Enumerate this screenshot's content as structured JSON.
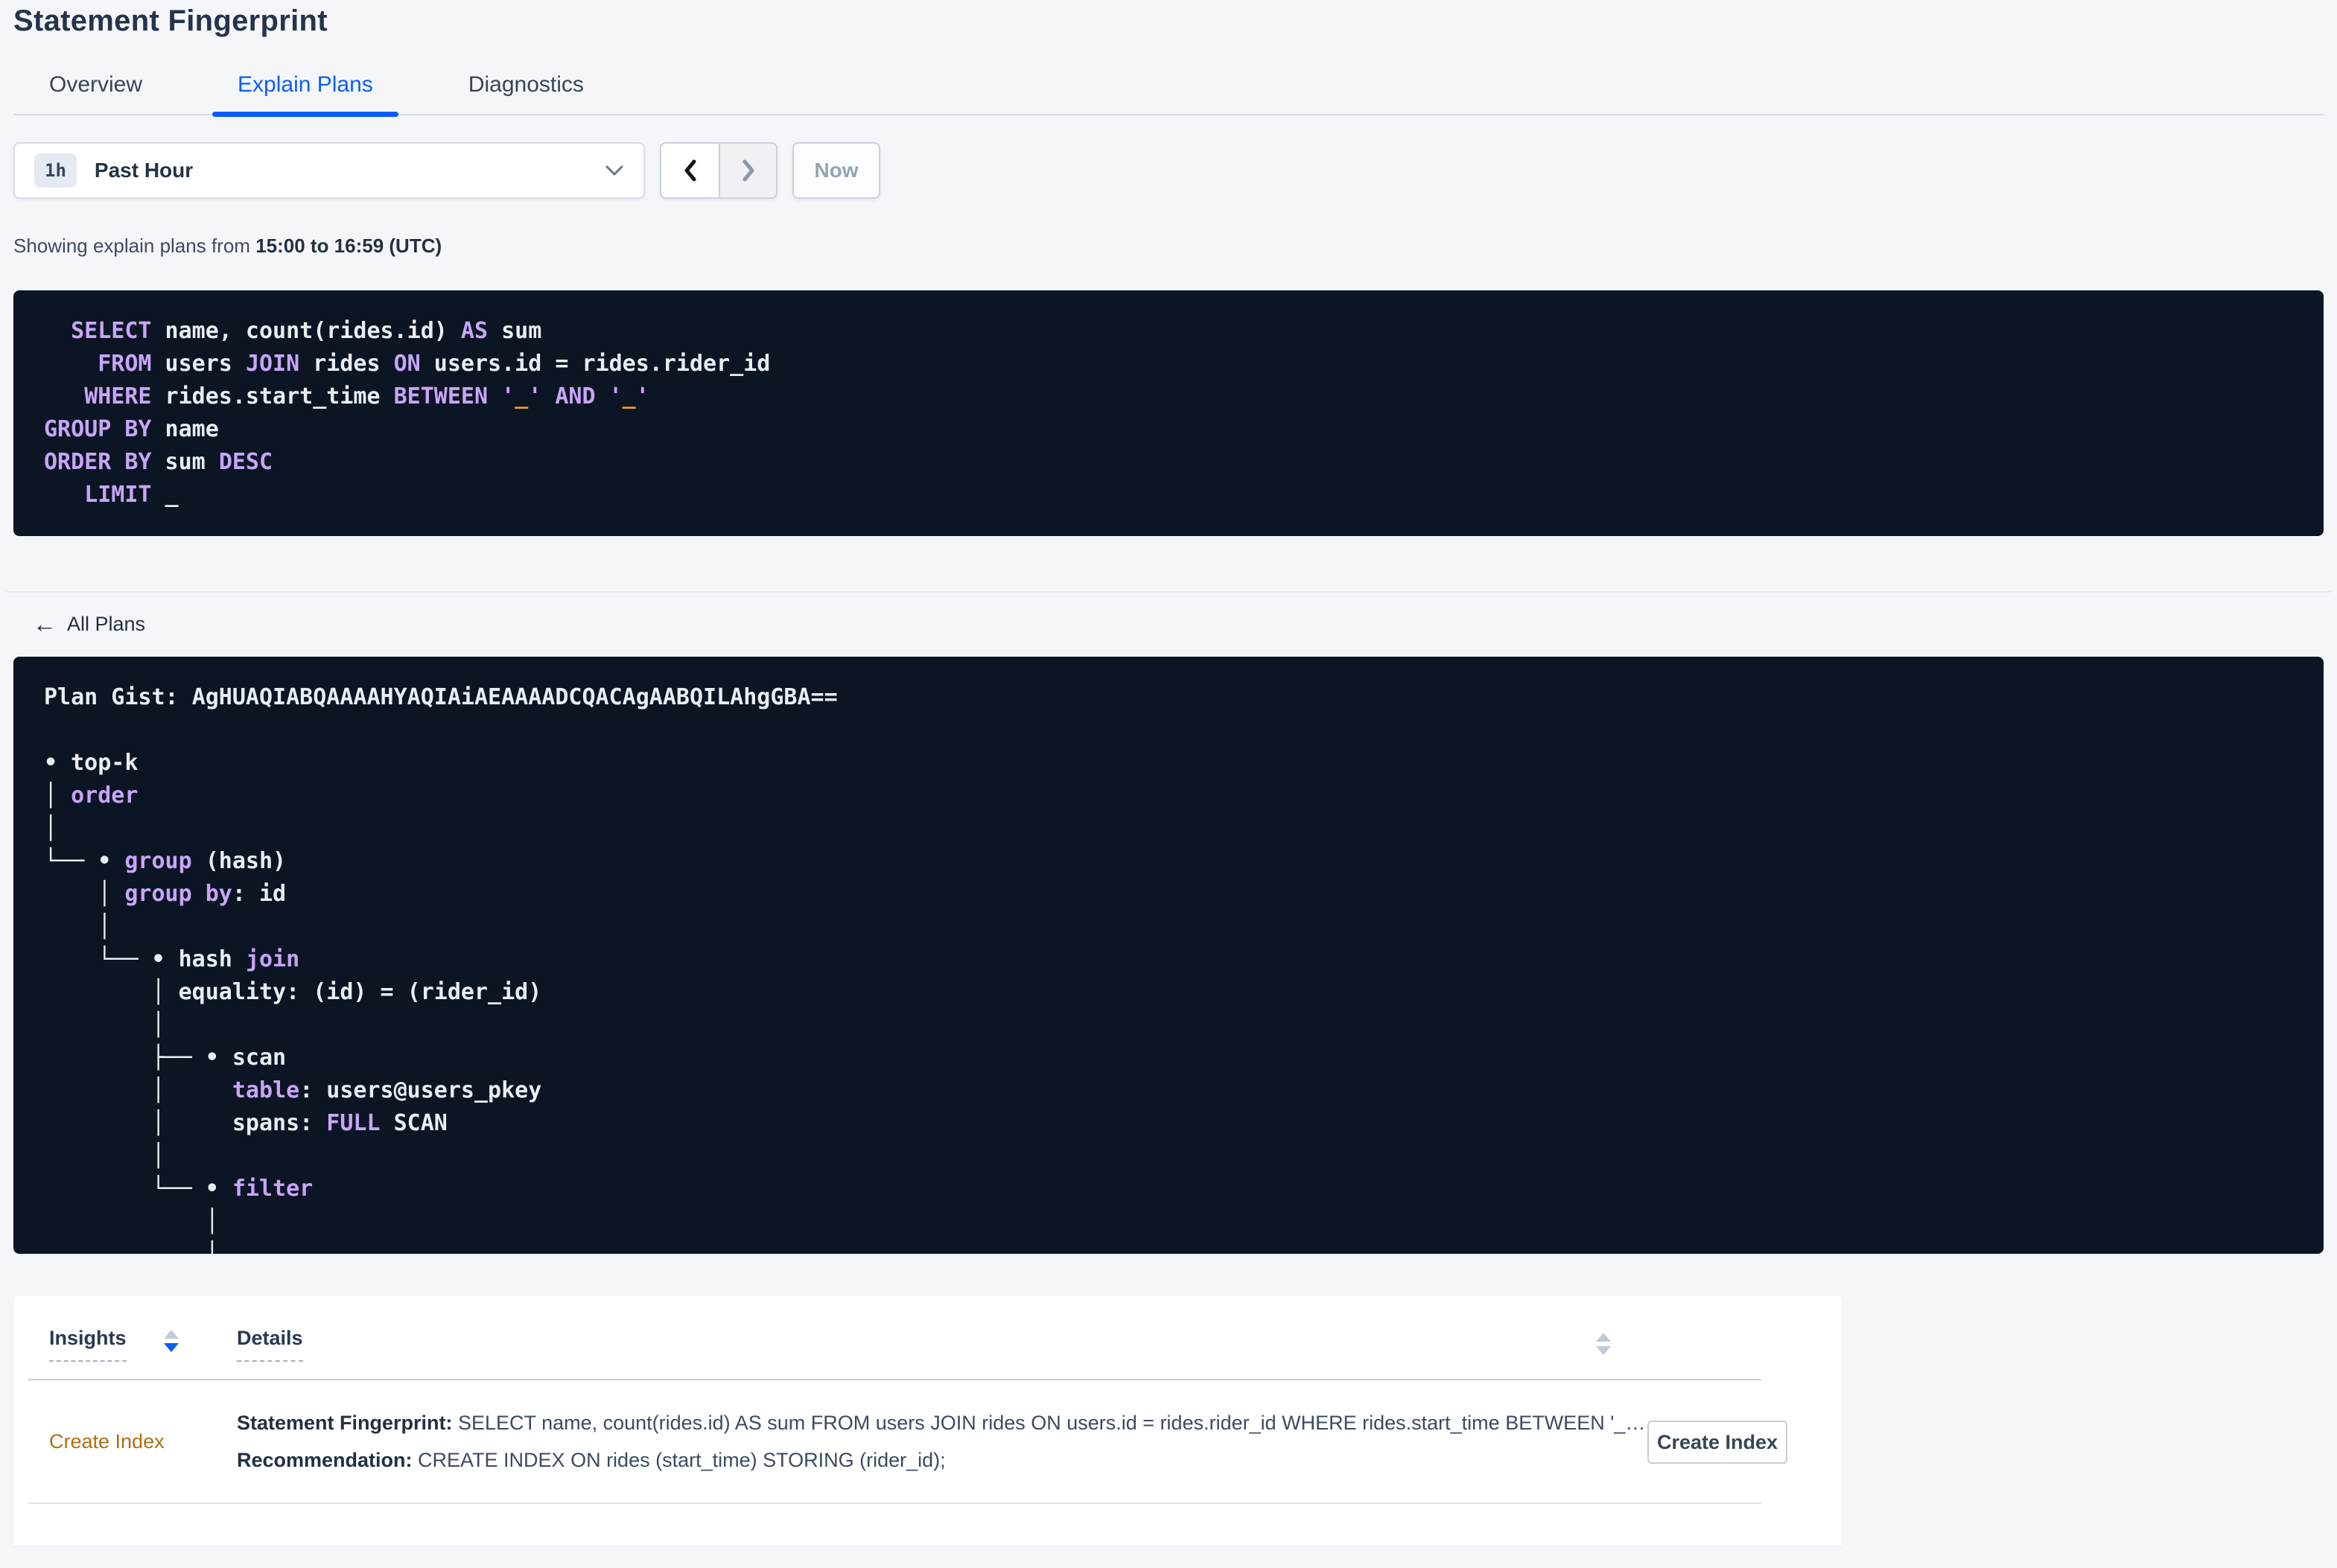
{
  "header": {
    "title": "Statement Fingerprint"
  },
  "tabs": [
    {
      "label": "Overview",
      "active": false
    },
    {
      "label": "Explain Plans",
      "active": true
    },
    {
      "label": "Diagnostics",
      "active": false
    }
  ],
  "time_controls": {
    "range_badge": "1h",
    "range_label": "Past Hour",
    "now_label": "Now"
  },
  "subtitle": {
    "prefix": "Showing explain plans from ",
    "range_bold": "15:00 to 16:59 (UTC)"
  },
  "colors": {
    "accent_blue": "#0a5dff",
    "code_background": "#0c1524",
    "keyword_purple": "#c8a5f7",
    "literal_orange": "#ee9d1d",
    "insight_link_orange": "#b06f10"
  },
  "sql": {
    "lines": [
      [
        {
          "t": "  ",
          "c": "pl"
        },
        {
          "t": "SELECT",
          "c": "kw"
        },
        {
          "t": " name, count(rides.id) ",
          "c": "pl"
        },
        {
          "t": "AS",
          "c": "kw"
        },
        {
          "t": " sum",
          "c": "pl"
        }
      ],
      [
        {
          "t": "    ",
          "c": "pl"
        },
        {
          "t": "FROM",
          "c": "kw"
        },
        {
          "t": " users ",
          "c": "pl"
        },
        {
          "t": "JOIN",
          "c": "kw"
        },
        {
          "t": " rides ",
          "c": "pl"
        },
        {
          "t": "ON",
          "c": "kw"
        },
        {
          "t": " users.id = rides.rider_id",
          "c": "pl"
        }
      ],
      [
        {
          "t": "   ",
          "c": "pl"
        },
        {
          "t": "WHERE",
          "c": "kw"
        },
        {
          "t": " rides.start_time ",
          "c": "pl"
        },
        {
          "t": "BETWEEN",
          "c": "kw"
        },
        {
          "t": " ",
          "c": "pl"
        },
        {
          "t": "'",
          "c": "kw"
        },
        {
          "t": "_",
          "c": "or"
        },
        {
          "t": "'",
          "c": "kw"
        },
        {
          "t": " ",
          "c": "pl"
        },
        {
          "t": "AND",
          "c": "kw"
        },
        {
          "t": " ",
          "c": "pl"
        },
        {
          "t": "'",
          "c": "kw"
        },
        {
          "t": "_",
          "c": "or"
        },
        {
          "t": "'",
          "c": "kw"
        }
      ],
      [
        {
          "t": "GROUP BY",
          "c": "kw"
        },
        {
          "t": " name",
          "c": "pl"
        }
      ],
      [
        {
          "t": "ORDER BY",
          "c": "kw"
        },
        {
          "t": " sum ",
          "c": "pl"
        },
        {
          "t": "DESC",
          "c": "kw"
        }
      ],
      [
        {
          "t": "   ",
          "c": "pl"
        },
        {
          "t": "LIMIT",
          "c": "kw"
        },
        {
          "t": " _",
          "c": "pl"
        }
      ]
    ]
  },
  "back_link": {
    "label": "All Plans"
  },
  "plan": {
    "gist_label": "Plan Gist:",
    "gist_value": "AgHUAQIABQAAAAHYAQIAiAEAAAADCQACAgAABQILAhgGBA==",
    "lines": [
      [
        {
          "t": "Plan Gist: ",
          "c": "pl"
        },
        {
          "t": "AgHUAQIABQAAAAHYAQIAiAEAAAADCQACAgAABQILAhgGBA==",
          "c": "pl"
        }
      ],
      [],
      [
        {
          "t": "• ",
          "c": "pl"
        },
        {
          "t": "top-k",
          "c": "pl"
        }
      ],
      [
        {
          "t": "│ ",
          "c": "pl"
        },
        {
          "t": "order",
          "c": "kw"
        }
      ],
      [
        {
          "t": "│",
          "c": "pl"
        }
      ],
      [
        {
          "t": "└── • ",
          "c": "pl"
        },
        {
          "t": "group",
          "c": "kw"
        },
        {
          "t": " (hash)",
          "c": "pl"
        }
      ],
      [
        {
          "t": "    │ ",
          "c": "pl"
        },
        {
          "t": "group by",
          "c": "kw"
        },
        {
          "t": ": id",
          "c": "pl"
        }
      ],
      [
        {
          "t": "    │",
          "c": "pl"
        }
      ],
      [
        {
          "t": "    └── • ",
          "c": "pl"
        },
        {
          "t": "hash ",
          "c": "pl"
        },
        {
          "t": "join",
          "c": "kw"
        }
      ],
      [
        {
          "t": "        │ equality: (id) = (rider_id)",
          "c": "pl"
        }
      ],
      [
        {
          "t": "        │",
          "c": "pl"
        }
      ],
      [
        {
          "t": "        ├── • ",
          "c": "pl"
        },
        {
          "t": "scan",
          "c": "pl"
        }
      ],
      [
        {
          "t": "        │     ",
          "c": "pl"
        },
        {
          "t": "table",
          "c": "kw"
        },
        {
          "t": ": users@users_pkey",
          "c": "pl"
        }
      ],
      [
        {
          "t": "        │     spans: ",
          "c": "pl"
        },
        {
          "t": "FULL",
          "c": "kw"
        },
        {
          "t": " SCAN",
          "c": "pl"
        }
      ],
      [
        {
          "t": "        │",
          "c": "pl"
        }
      ],
      [
        {
          "t": "        └── • ",
          "c": "pl"
        },
        {
          "t": "filter",
          "c": "kw"
        }
      ],
      [
        {
          "t": "            │",
          "c": "pl"
        }
      ],
      [
        {
          "t": "            │",
          "c": "pl"
        }
      ]
    ]
  },
  "insights_table": {
    "col_insights": "Insights",
    "col_details": "Details",
    "row": {
      "insight": "Create Index",
      "fingerprint_label": "Statement Fingerprint:",
      "fingerprint_value": " SELECT name, count(rides.id) AS sum FROM users JOIN rides ON users.id = rides.rider_id WHERE rides.start_time BETWEEN '_…",
      "recommendation_label": "Recommendation:",
      "recommendation_value": " CREATE INDEX ON rides (start_time) STORING (rider_id);",
      "action": "Create Index"
    }
  }
}
